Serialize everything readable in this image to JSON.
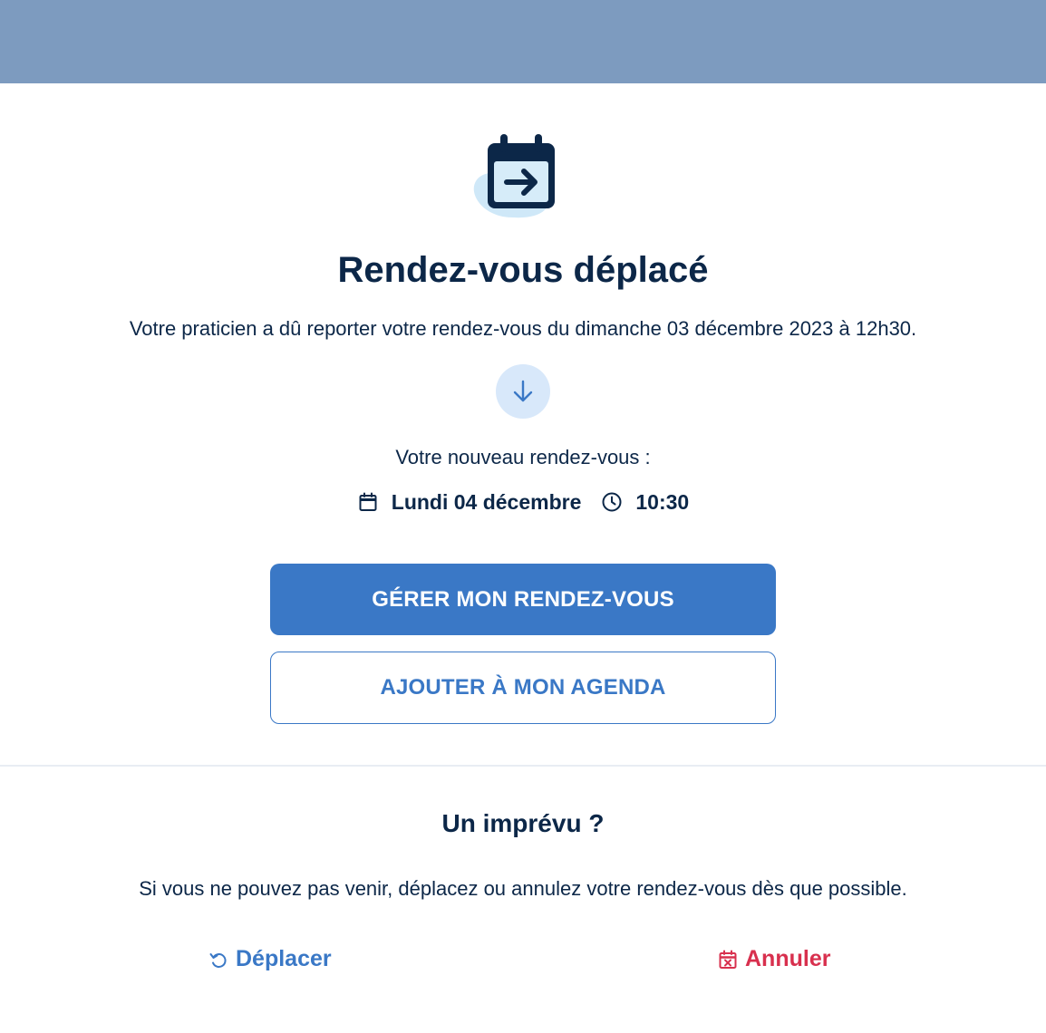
{
  "colors": {
    "banner": "#7d9bbf",
    "navy": "#0c2748",
    "primary_blue": "#3a78c6",
    "light_blue": "#d8e8fa",
    "danger_red": "#d8304e"
  },
  "hero": {
    "icon": "calendar-arrow-right-icon",
    "title": "Rendez-vous déplacé",
    "notice": "Votre praticien a dû reporter votre rendez-vous du dimanche 03 décembre 2023 à 12h30."
  },
  "divider_icon": "arrow-down-icon",
  "new_appointment": {
    "label": "Votre nouveau rendez-vous :",
    "date_icon": "calendar-icon",
    "date": "Lundi 04 décembre",
    "time_icon": "clock-icon",
    "time": "10:30"
  },
  "buttons": {
    "manage": "GÉRER MON RENDEZ-VOUS",
    "add_to_calendar": "AJOUTER À MON AGENDA"
  },
  "unexpected": {
    "title": "Un imprévu ?",
    "text": "Si vous ne pouvez pas venir, déplacez ou annulez votre rendez-vous dès que possible.",
    "move_icon": "undo-arrow-icon",
    "move_label": "Déplacer",
    "cancel_icon": "calendar-x-icon",
    "cancel_label": "Annuler"
  }
}
